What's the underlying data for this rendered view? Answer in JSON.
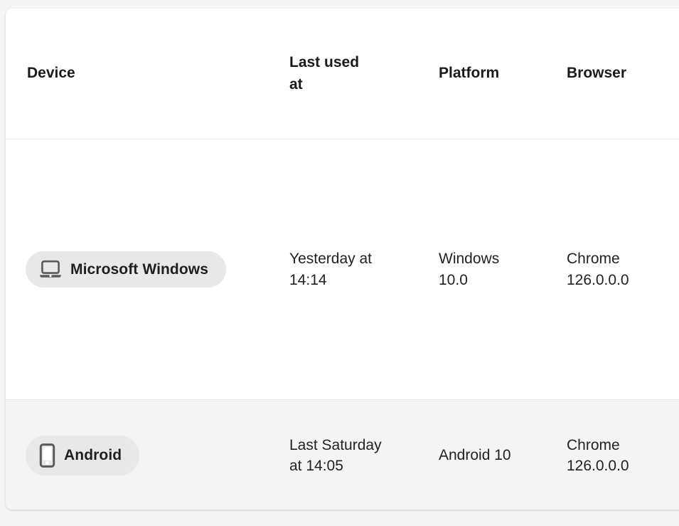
{
  "table": {
    "columns": [
      {
        "key": "device",
        "label": "Device"
      },
      {
        "key": "lastused",
        "label": "Last used at"
      },
      {
        "key": "platform",
        "label": "Platform"
      },
      {
        "key": "browser",
        "label": "Browser"
      }
    ],
    "rows": [
      {
        "device_label": "Microsoft Windows",
        "device_icon": "laptop-icon",
        "last_used_at": "Yesterday at 14:14",
        "platform": "Windows 10.0",
        "browser": "Chrome 126.0.0.0",
        "row_background": "#ffffff"
      },
      {
        "device_label": "Android",
        "device_icon": "mobile-phone-icon",
        "last_used_at": "Last Saturday at 14:05",
        "platform": "Android 10",
        "browser": "Chrome 126.0.0.0",
        "row_background": "#f4f4f4"
      }
    ]
  },
  "colors": {
    "page_background": "#f5f5f5",
    "card_background": "#ffffff",
    "pill_background": "#e8e8e8",
    "icon_color": "#5a5a5a",
    "text_primary": "#222222",
    "header_text": "#1a1a1a",
    "row_divider": "#e7e7e7",
    "alt_row_background": "#f4f4f4"
  }
}
